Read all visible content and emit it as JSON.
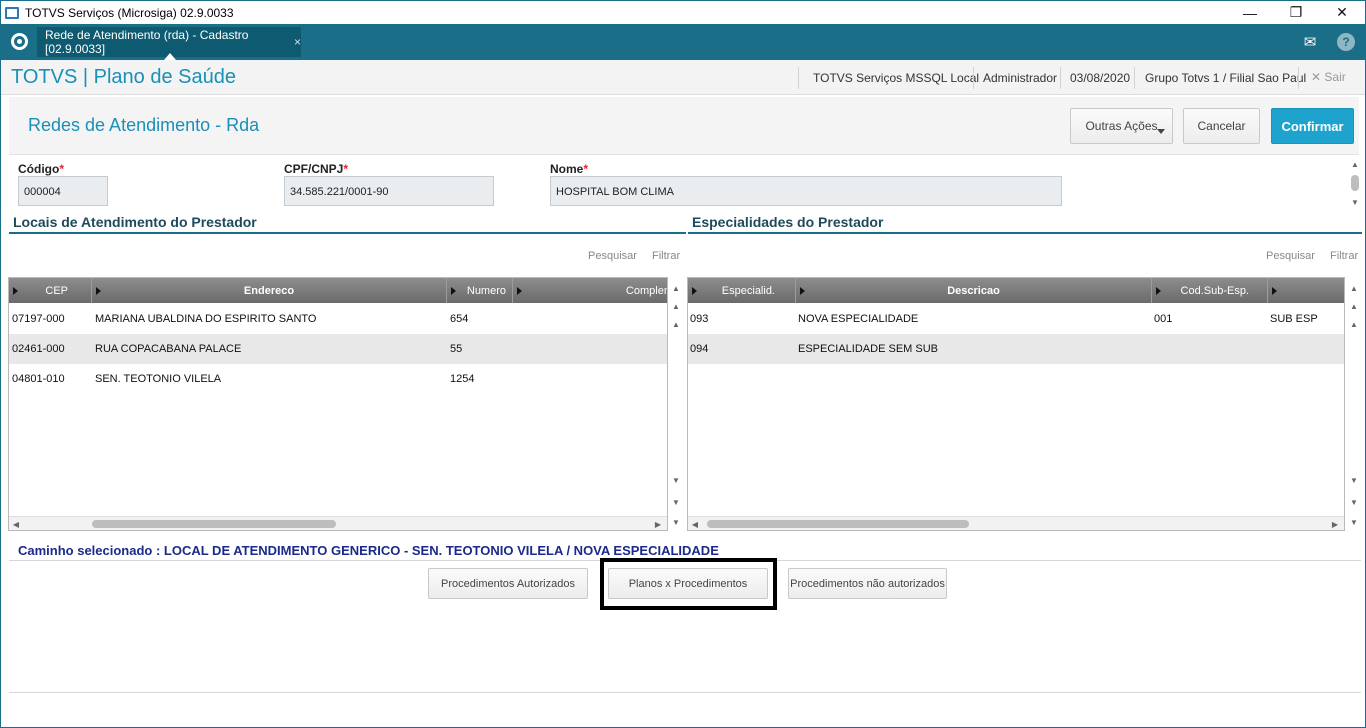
{
  "window": {
    "title": "TOTVS Serviços (Microsiga) 02.9.0033",
    "minimize_glyph": "—",
    "maximize_glyph": "❐",
    "close_glyph": "✕"
  },
  "tabbar": {
    "tab_label": "Rede de Atendimento (rda) - Cadastro [02.9.0033]",
    "tab_close": "×",
    "mail_glyph": "✉",
    "help_glyph": "?"
  },
  "header": {
    "brand": "TOTVS | Plano de Saúde",
    "environment": "TOTVS Serviços MSSQL Local",
    "user": "Administrador",
    "date": "03/08/2020",
    "company": "Grupo Totvs 1 / Filial Sao Paul",
    "exit_label": "✕  Sair"
  },
  "page": {
    "title": "Redes de Atendimento - Rda",
    "buttons": {
      "more_actions": "Outras Ações",
      "cancel": "Cancelar",
      "confirm": "Confirmar"
    }
  },
  "form": {
    "codigo": {
      "label": "Código",
      "value": "000004"
    },
    "cpf_cnpj": {
      "label": "CPF/CNPJ",
      "value": "34.585.221/0001-90"
    },
    "nome": {
      "label": "Nome",
      "value": "HOSPITAL BOM CLIMA"
    },
    "required_mark": "*"
  },
  "locais": {
    "title": "Locais de Atendimento do Prestador",
    "search": "Pesquisar",
    "filter": "Filtrar",
    "columns": [
      "CEP",
      "Endereco",
      "Numero",
      "Complem"
    ],
    "rows": [
      [
        "07197-000",
        "MARIANA UBALDINA DO ESPIRITO SANTO",
        "654",
        ""
      ],
      [
        "02461-000",
        "RUA COPACABANA PALACE",
        "55",
        ""
      ],
      [
        "04801-010",
        "SEN. TEOTONIO VILELA",
        "1254",
        ""
      ]
    ]
  },
  "especialidades": {
    "title": "Especialidades do Prestador",
    "search": "Pesquisar",
    "filter": "Filtrar",
    "columns": [
      "Especialid.",
      "Descricao",
      "Cod.Sub-Esp.",
      ""
    ],
    "rows": [
      [
        "093",
        "NOVA ESPECIALIDADE",
        "001",
        "SUB ESP"
      ],
      [
        "094",
        "ESPECIALIDADE  SEM SUB",
        "",
        ""
      ]
    ]
  },
  "bottom": {
    "selected_path": "Caminho selecionado : LOCAL DE ATENDIMENTO GENERICO - SEN. TEOTONIO VILELA / NOVA ESPECIALIDADE",
    "btn_authorized": "Procedimentos Autorizados",
    "btn_plans": "Planos x Procedimentos",
    "btn_unauthorized": "Procedimentos não autorizados"
  },
  "colors": {
    "accent": "#1a6e87",
    "brand_text": "#1a8fb7",
    "primary_button": "#1ea3cf",
    "path_text": "#1b2a8a"
  }
}
